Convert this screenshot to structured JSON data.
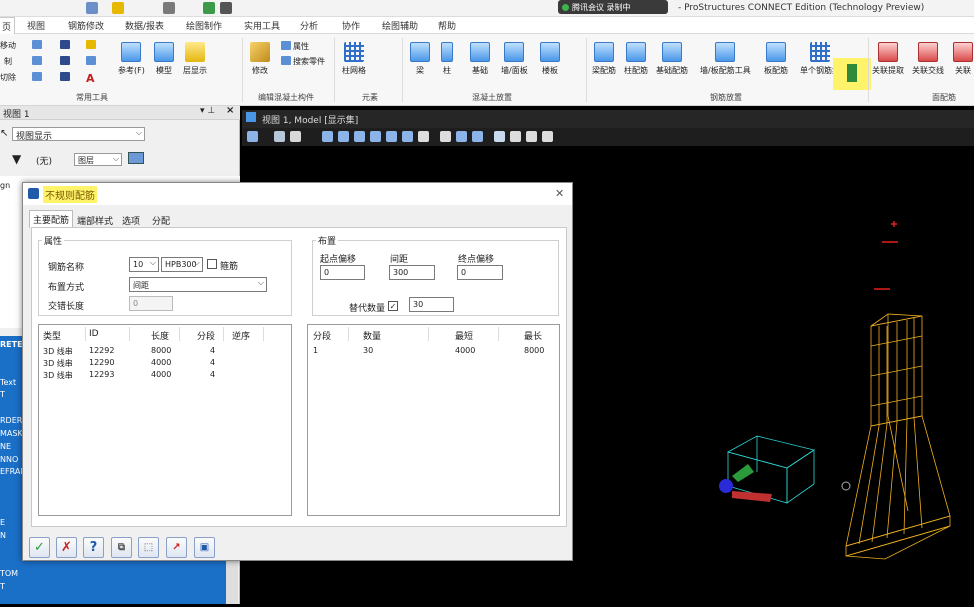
{
  "app": {
    "title": "- ProStructures CONNECT Edition (Technology Preview)",
    "meeting_text": "腾讯会议 录制中"
  },
  "tabs": [
    "页",
    "视图",
    "钢筋修改",
    "数据/报表",
    "绘图制作",
    "实用工具",
    "分析",
    "协作",
    "绘图辅助",
    "帮助"
  ],
  "ribbon": {
    "small_left": [
      "移动",
      "制",
      "切除"
    ],
    "ref_label": "参考(F)",
    "model_label": "模型",
    "layer_label": "层显示",
    "group_common": "常用工具",
    "modify_label": "修改",
    "attr_label": "属性",
    "search_label": "搜索零件",
    "group_edit": "编辑混凝土构件",
    "mesh_label": "柱网格",
    "group_element": "元素",
    "beam": "梁",
    "column": "柱",
    "foundation": "基础",
    "wall": "墙/面板",
    "slab": "楼板",
    "group_concrete": "混凝土放置",
    "beam_rebar": "梁配筋",
    "col_rebar": "柱配筋",
    "found_rebar": "基础配筋",
    "wall_rebar": "墙/板配筋工具",
    "slab_rebar": "板配筋",
    "single_rebar": "单个钢筋集",
    "group_rebar": "钢筋放置",
    "assoc_extract": "关联提取",
    "assoc_intersect": "关联交线",
    "assoc_more": "关联",
    "group_face": "面配筋"
  },
  "left_panel": {
    "title": "视图 1",
    "display": "视图显示",
    "filter_value": "(无)",
    "layer_value": "图层",
    "tree_item": "gn",
    "blue_items": [
      "RETE",
      "Text",
      "T",
      "RDER",
      "MASK",
      "NE",
      "NNO",
      "EFRAN",
      "E",
      "N",
      "TOM",
      "T"
    ]
  },
  "viewport": {
    "title": "视图 1, Model [显示集]"
  },
  "dialog": {
    "title": "不规则配筋",
    "tabs": [
      "主要配筋",
      "端部样式",
      "选项",
      "分配"
    ],
    "props_group": "属性",
    "rebar_name_label": "钢筋名称",
    "rebar_size": "10",
    "rebar_grade": "HPB300",
    "stirrup_label": "箍筋",
    "layout_label": "布置方式",
    "layout_value": "间距",
    "lap_label": "交错长度",
    "lap_value": "0",
    "layout_group": "布置",
    "start_offset_label": "起点偏移",
    "start_offset": "0",
    "spacing_label": "间距",
    "spacing": "300",
    "end_offset_label": "终点偏移",
    "end_offset": "0",
    "replace_count_label": "替代数量",
    "replace_count": "30",
    "left_table": {
      "headers": [
        "类型",
        "ID",
        "长度",
        "分段",
        "逆序"
      ],
      "rows": [
        [
          "3D 线串",
          "12292",
          "8000",
          "4",
          ""
        ],
        [
          "3D 线串",
          "12290",
          "4000",
          "4",
          ""
        ],
        [
          "3D 线串",
          "12293",
          "4000",
          "4",
          ""
        ]
      ]
    },
    "right_table": {
      "headers": [
        "分段",
        "数量",
        "最短",
        "最长"
      ],
      "rows": [
        [
          "1",
          "30",
          "4000",
          "8000"
        ]
      ]
    }
  },
  "colors": {
    "highlight": "#fff36a",
    "ribbon_accent": "#4a97e8",
    "model_yellow": "#f0b020",
    "panel_blue": "#1a6fc7"
  }
}
